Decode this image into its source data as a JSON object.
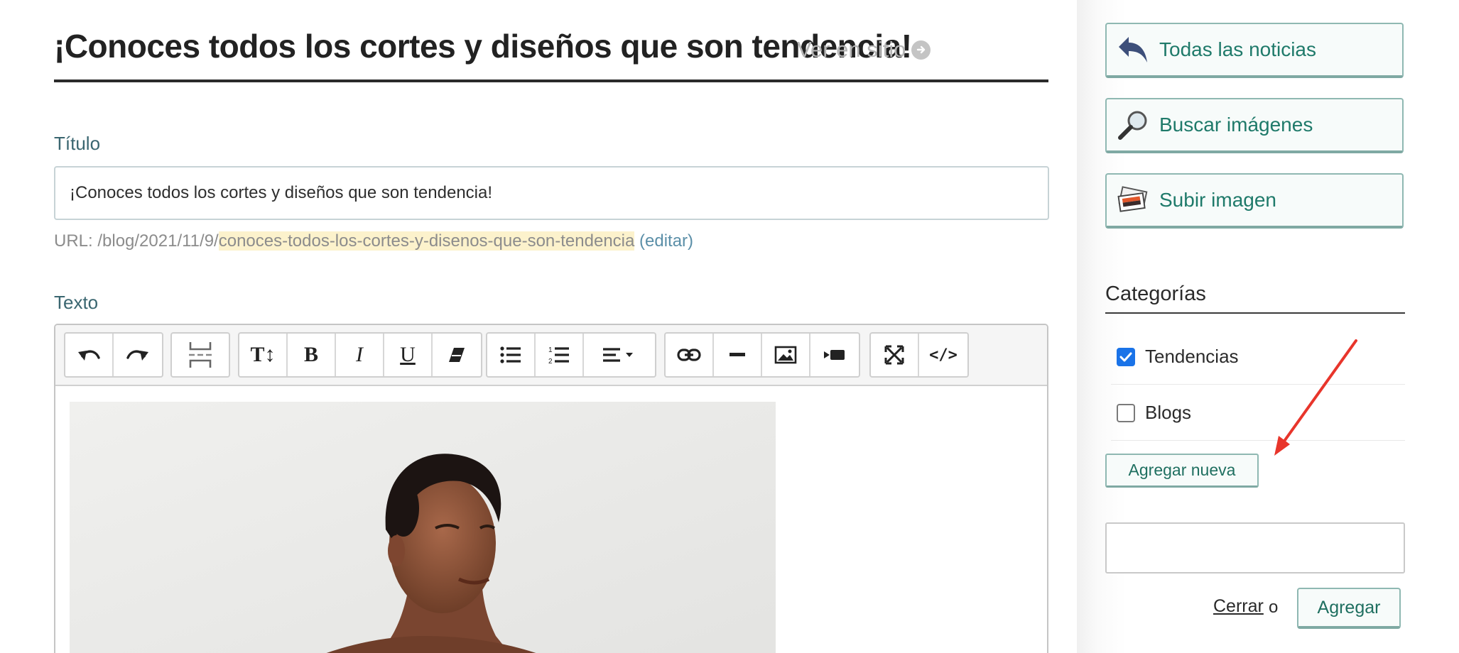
{
  "header": {
    "title": "¡Conoces todos los cortes y diseños que son tendencia!",
    "view_link": "Ver en sitio"
  },
  "form": {
    "title_label": "Título",
    "title_value": "¡Conoces todos los cortes y diseños que son tendencia!",
    "url_prefix": "URL: /blog/2021/11/9/",
    "url_slug": "conoces-todos-los-cortes-y-disenos-que-son-tendencia",
    "url_edit": "(editar)",
    "text_label": "Texto"
  },
  "toolbar": {
    "groups": [
      [
        "undo-icon",
        "redo-icon"
      ],
      [
        "page-break-icon"
      ],
      [
        "text-size-icon",
        "bold-icon",
        "italic-icon",
        "underline-icon",
        "eraser-icon"
      ],
      [
        "bullet-list-icon",
        "numbered-list-icon",
        "align-dropdown-icon"
      ],
      [
        "link-icon",
        "horizontal-rule-icon",
        "image-icon",
        "video-icon"
      ],
      [
        "fullscreen-icon",
        "code-view-icon"
      ]
    ],
    "labels": {
      "text_size": "T↕",
      "bold": "B",
      "italic": "I",
      "underline": "U",
      "code": "</>"
    }
  },
  "sidebar": {
    "all_news": "Todas las noticias",
    "search_images": "Buscar imágenes",
    "upload_image": "Subir imagen",
    "categories_title": "Categorías",
    "categories": [
      {
        "label": "Tendencias",
        "checked": true
      },
      {
        "label": "Blogs",
        "checked": false
      }
    ],
    "add_new": "Agregar nueva",
    "new_category_value": "",
    "close_label": "Cerrar",
    "or_label": "o",
    "add_label": "Agregar"
  },
  "colors": {
    "accent": "#1f7a6a",
    "label": "#3a6670",
    "url_highlight": "#fcf2cc",
    "annotation_arrow": "#e8352b",
    "checkbox": "#1a73e8"
  }
}
